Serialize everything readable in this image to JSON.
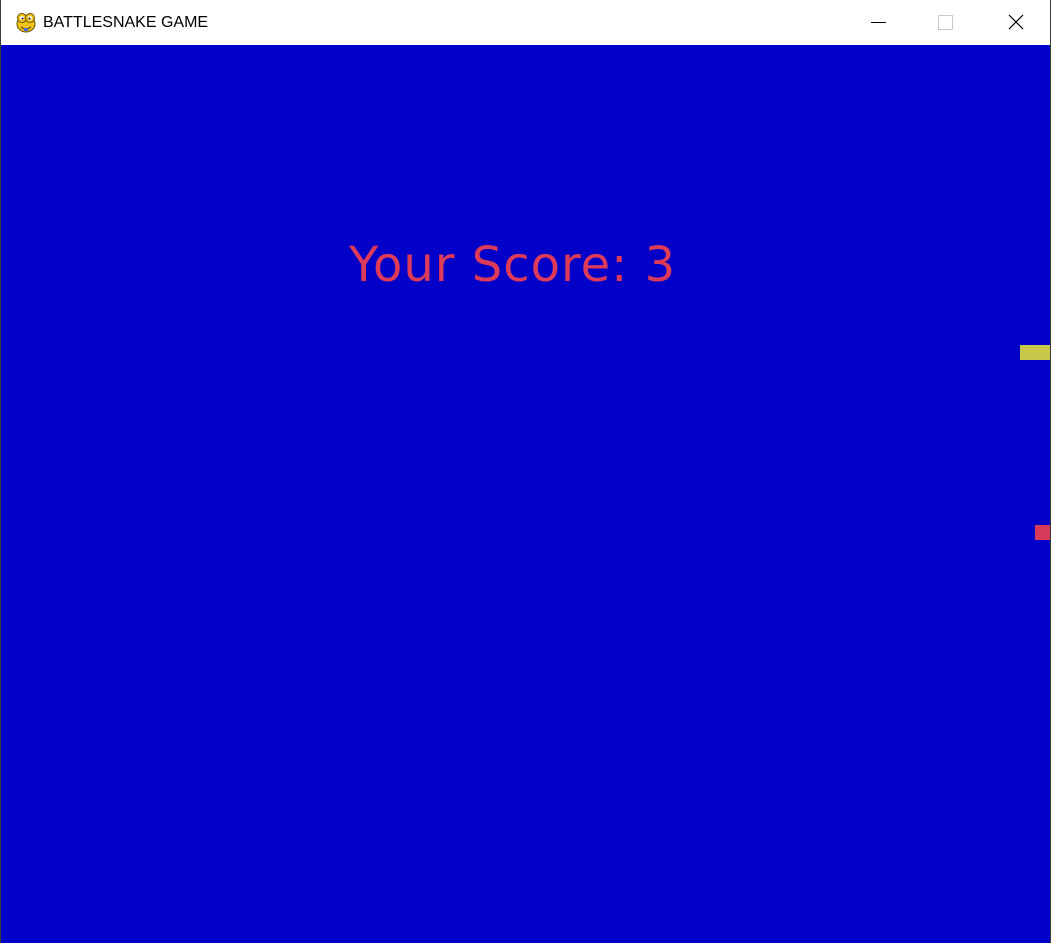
{
  "window": {
    "title": "BATTLESNAKE GAME",
    "app_icon": "pygame-snake-icon",
    "controls": {
      "minimize_icon": "minimize-icon",
      "maximize_icon": "maximize-icon",
      "close_icon": "close-icon"
    }
  },
  "game": {
    "score_text": "Your Score: 3",
    "colors": {
      "background": "#0000c8",
      "score_text": "#dd3a5a",
      "snake": "#c8c84a",
      "food": "#d83a5a"
    }
  }
}
